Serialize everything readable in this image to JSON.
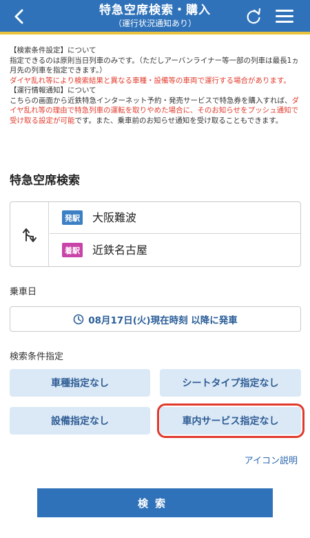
{
  "header": {
    "title": "特急空席検索・購入",
    "subtitle": "（運行状況通知あり）"
  },
  "info": {
    "line1": "【検索条件設定】について",
    "line2": "指定できるのは原則当日列車のみです。（ただしアーバンライナー等一部の列車は最長1ヵ月先の列車を指定できます。）",
    "line3_red": "ダイヤ乱れ等により検索結果と異なる車種・設備等の車両で運行する場合があります。",
    "line4": "【運行情報通知】について",
    "line5_a": "こちらの画面から近鉄特急インターネット予約・発売サービスで特急券を購入すれば、",
    "line5_red1": "ダイヤ乱れ等の理由で特急列車の運転を取りやめた場合に、そのお知らせをプッシュ通知で受け取る設定が可能",
    "line5_b": "です。また、乗車前のお知らせ通知を受け取ることもできます。"
  },
  "search": {
    "section_title": "特急空席検索",
    "departure_badge": "発駅",
    "departure_station": "大阪難波",
    "arrival_badge": "着駅",
    "arrival_station": "近鉄名古屋",
    "date_label": "乗車日",
    "date_value": "08月17日(火)現在時刻 以降に発車",
    "conditions_label": "検索条件指定",
    "cond_car_type": "車種指定なし",
    "cond_seat_type": "シートタイプ指定なし",
    "cond_equipment": "設備指定なし",
    "cond_service": "車内サービス指定なし",
    "icon_help": "アイコン説明",
    "search_button": "検索"
  },
  "colors": {
    "header": "#2f72b9",
    "accent_stripe": "#e8c23a",
    "warning_red": "#e23a2c",
    "condition_bg": "#dbe9f6",
    "highlight": "#e0392b"
  }
}
